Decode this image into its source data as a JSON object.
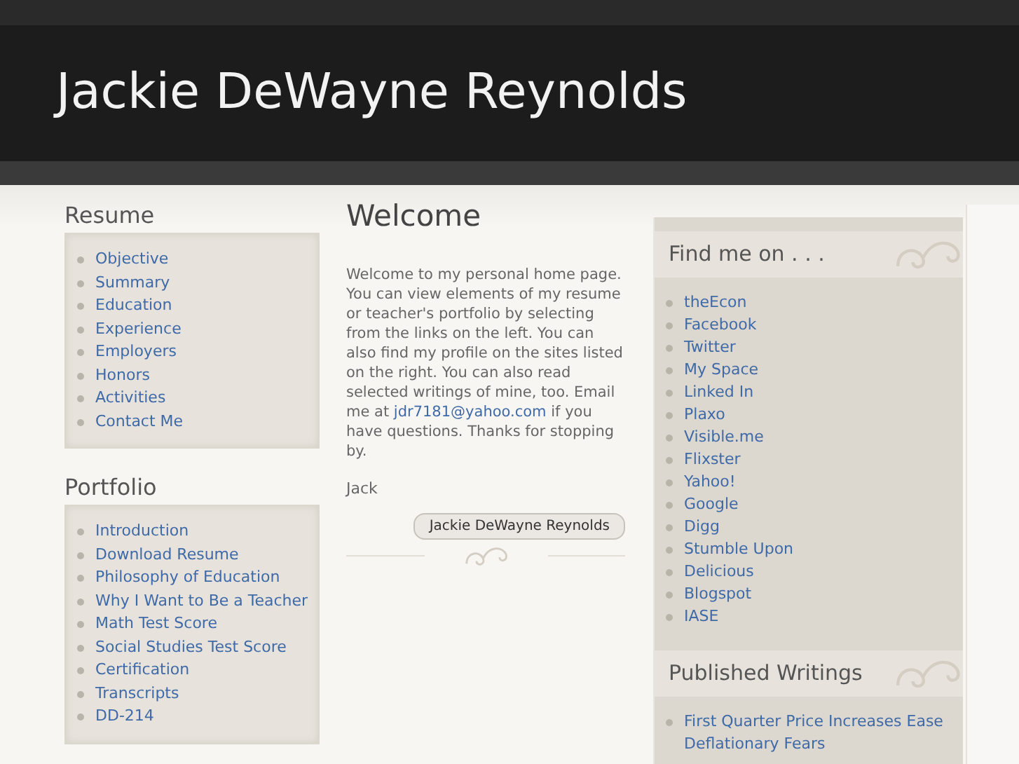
{
  "site_title": "Jackie DeWayne Reynolds",
  "left": [
    {
      "heading": "Resume",
      "links": [
        "Objective",
        "Summary",
        "Education",
        "Experience",
        "Employers",
        "Honors",
        "Activities",
        "Contact Me"
      ]
    },
    {
      "heading": "Portfolio",
      "links": [
        "Introduction",
        "Download Resume",
        "Philosophy of Education",
        "Why I Want to Be a Teacher",
        "Math Test Score",
        "Social Studies Test Score",
        "Certification",
        "Transcripts",
        "DD-214"
      ]
    }
  ],
  "main": {
    "heading": "Welcome",
    "paragraph_before": "Welcome to my personal home page. You can view elements of my resume or teacher's portfolio by selecting from the links on the left. You can also find my profile on the sites listed on the right. You can also read selected writings of mine, too. Email me at",
    "email": "jdr7181@yahoo.com",
    "paragraph_after": "if you have questions. Thanks for stopping by.",
    "signature": "Jack",
    "author_button": "Jackie DeWayne Reynolds"
  },
  "right": [
    {
      "heading": "Find me on . . .",
      "links": [
        "theEcon",
        "Facebook",
        "Twitter",
        "My Space",
        "Linked In",
        "Plaxo",
        "Visible.me",
        "Flixster",
        "Yahoo!",
        "Google",
        "Digg",
        "Stumble Upon",
        "Delicious",
        "Blogspot",
        "IASE"
      ]
    },
    {
      "heading": "Published Writings",
      "links": [
        "First Quarter Price Increases Ease Deflationary Fears"
      ]
    }
  ]
}
